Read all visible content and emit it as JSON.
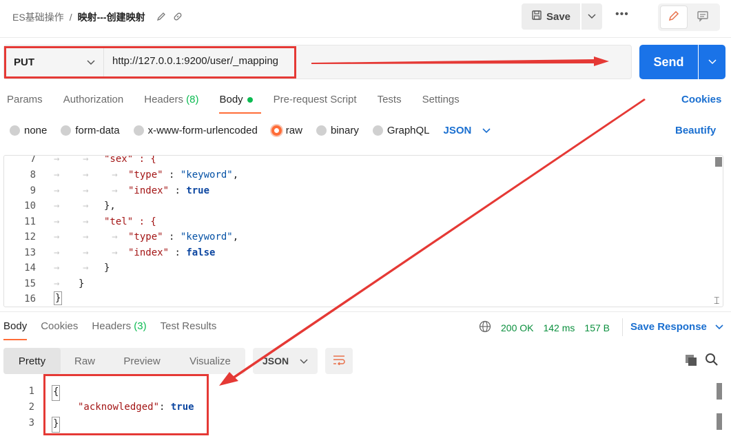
{
  "header": {
    "collection": "ES基础操作",
    "separator": "/",
    "request_name": "映射---创建映射",
    "save_label": "Save",
    "more_label": "•••"
  },
  "request": {
    "method": "PUT",
    "url": "http://127.0.0.1:9200/user/_mapping",
    "send_label": "Send"
  },
  "request_tabs": {
    "params": "Params",
    "authorization": "Authorization",
    "headers": "Headers",
    "headers_count": "(8)",
    "body": "Body",
    "prerequest": "Pre-request Script",
    "tests": "Tests",
    "settings": "Settings",
    "cookies": "Cookies"
  },
  "body_types": {
    "none": "none",
    "form_data": "form-data",
    "urlencoded": "x-www-form-urlencoded",
    "raw": "raw",
    "binary": "binary",
    "graphql": "GraphQL",
    "format": "JSON",
    "beautify": "Beautify"
  },
  "editor": {
    "line_numbers": [
      "7",
      "8",
      "9",
      "10",
      "11",
      "12",
      "13",
      "14",
      "15",
      "16"
    ],
    "l7": "\"sex\" : {",
    "l8_key": "\"type\"",
    "l8_val": "\"keyword\"",
    "l9_key": "\"index\"",
    "l9_val": "true",
    "l10": "},",
    "l11": "\"tel\" : {",
    "l12_key": "\"type\"",
    "l12_val": "\"keyword\"",
    "l13_key": "\"index\"",
    "l13_val": "false",
    "l14": "}",
    "l15": "}",
    "l16": "}"
  },
  "response_tabs": {
    "body": "Body",
    "cookies": "Cookies",
    "headers": "Headers",
    "headers_count": "(3)",
    "test_results": "Test Results"
  },
  "response_status": {
    "status": "200 OK",
    "time": "142 ms",
    "size": "157 B",
    "save_response": "Save Response"
  },
  "view_tabs": {
    "pretty": "Pretty",
    "raw": "Raw",
    "preview": "Preview",
    "visualize": "Visualize",
    "format": "JSON"
  },
  "response_body": {
    "line_numbers": [
      "1",
      "2",
      "3"
    ],
    "open": "{",
    "key": "\"acknowledged\"",
    "value": "true",
    "close": "}"
  },
  "colors": {
    "send": "#1a73e8",
    "accent": "#ff6c37",
    "annotation": "#e53935",
    "link": "#1a6fd0",
    "success": "#0a8f3d"
  }
}
